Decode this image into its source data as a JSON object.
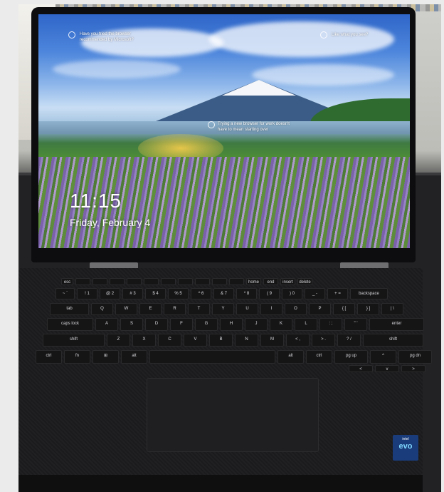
{
  "lockscreen": {
    "time": "11:15",
    "date": "Friday, February 4",
    "tip_left": "Have you tried the browser recommended by Microsoft?",
    "tip_right": "Like what you see?",
    "tip_center": "Trying a new browser for work doesn't have to mean starting over"
  },
  "keyboard": {
    "function_row": [
      "esc",
      "",
      "",
      "",
      "",
      "",
      "",
      "",
      "",
      "",
      "",
      "home",
      "end",
      "insert",
      "delete"
    ],
    "number_row": [
      "~ `",
      "! 1",
      "@ 2",
      "# 3",
      "$ 4",
      "% 5",
      "^ 6",
      "& 7",
      "* 8",
      "( 9",
      ") 0",
      "_ -",
      "+ =",
      "backspace"
    ],
    "qwerty_row": [
      "tab",
      "Q",
      "W",
      "E",
      "R",
      "T",
      "Y",
      "U",
      "I",
      "O",
      "P",
      "{ [",
      "} ]",
      "| \\"
    ],
    "home_row": [
      "caps lock",
      "A",
      "S",
      "D",
      "F",
      "G",
      "H",
      "J",
      "K",
      "L",
      ": ;",
      "\" '",
      "enter"
    ],
    "shift_row": [
      "shift",
      "Z",
      "X",
      "C",
      "V",
      "B",
      "N",
      "M",
      "< ,",
      "> .",
      "? /",
      "shift"
    ],
    "bottom_row": [
      "ctrl",
      "fn",
      "⊞",
      "alt",
      "",
      "alt",
      "ctrl",
      "pg up",
      "^",
      "pg dn"
    ],
    "arrow_row": [
      "<",
      "v",
      ">"
    ]
  },
  "badge": {
    "brand": "intel",
    "name": "evo"
  }
}
